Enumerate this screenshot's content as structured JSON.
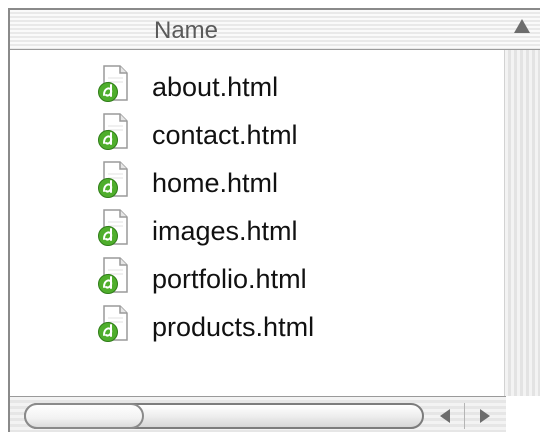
{
  "list": {
    "column_header": "Name",
    "sort_direction": "ascending",
    "files": [
      {
        "name": "about.html",
        "icon": "dreamweaver-html-file-icon"
      },
      {
        "name": "contact.html",
        "icon": "dreamweaver-html-file-icon"
      },
      {
        "name": "home.html",
        "icon": "dreamweaver-html-file-icon"
      },
      {
        "name": "images.html",
        "icon": "dreamweaver-html-file-icon"
      },
      {
        "name": "portfolio.html",
        "icon": "dreamweaver-html-file-icon"
      },
      {
        "name": "products.html",
        "icon": "dreamweaver-html-file-icon"
      }
    ]
  },
  "colors": {
    "icon_badge": "#4fae2c",
    "header_text": "#5a5a5a",
    "row_text": "#111111"
  }
}
